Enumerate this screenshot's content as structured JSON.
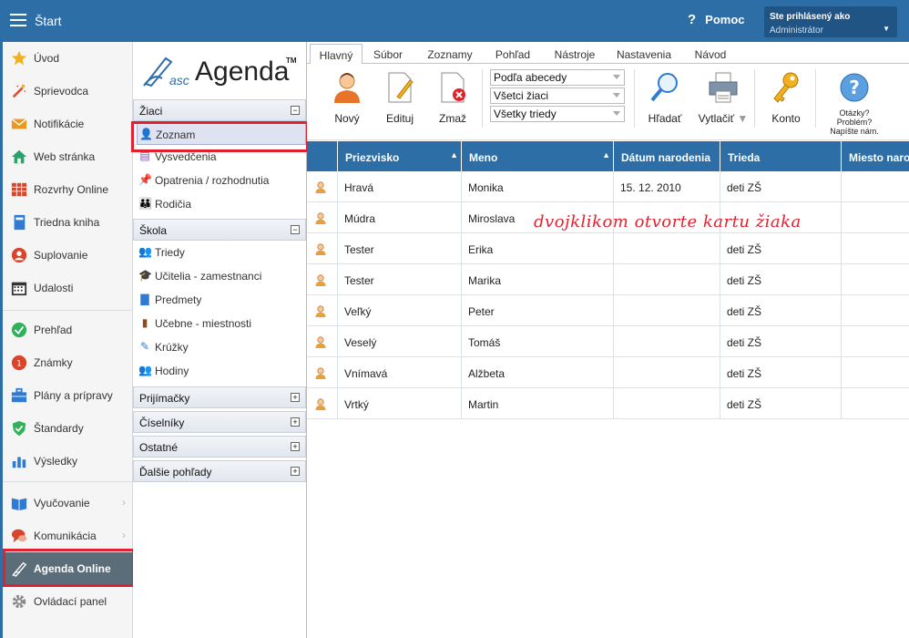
{
  "topbar": {
    "title": "Štart",
    "help": "Pomoc",
    "user_line1": "Ste prihlásený ako",
    "user_line2": "Administrátor"
  },
  "sidebar": {
    "items": [
      {
        "label": "Úvod",
        "icon": "star-icon",
        "color": "#f2b01e"
      },
      {
        "label": "Sprievodca",
        "icon": "magic-wand-icon",
        "color": "#e05030"
      },
      {
        "label": "Notifikácie",
        "icon": "envelope-icon",
        "color": "#e89a20"
      },
      {
        "label": "Web stránka",
        "icon": "home-icon",
        "color": "#2aa36a"
      },
      {
        "label": "Rozvrhy Online",
        "icon": "timetable-icon",
        "color": "#d9452b"
      },
      {
        "label": "Triedna kniha",
        "icon": "book-icon",
        "color": "#2e7bd1"
      },
      {
        "label": "Suplovanie",
        "icon": "person-icon",
        "color": "#d9452b"
      },
      {
        "label": "Udalosti",
        "icon": "calendar-icon",
        "color": "#333333"
      },
      {
        "label": "Prehľad",
        "icon": "check-circle-icon",
        "color": "#33b05a"
      },
      {
        "label": "Známky",
        "icon": "grade-icon",
        "color": "#d9452b"
      },
      {
        "label": "Plány a prípravy",
        "icon": "briefcase-icon",
        "color": "#2e7bd1"
      },
      {
        "label": "Štandardy",
        "icon": "shield-check-icon",
        "color": "#33b05a"
      },
      {
        "label": "Výsledky",
        "icon": "bar-chart-icon",
        "color": "#2e7bd1"
      },
      {
        "label": "Vyučovanie",
        "icon": "open-book-icon",
        "color": "#2e7bd1"
      },
      {
        "label": "Komunikácia",
        "icon": "chat-icon",
        "color": "#d9452b"
      },
      {
        "label": "Agenda Online",
        "icon": "pen-icon",
        "color": "#ffffff"
      },
      {
        "label": "Ovládací panel",
        "icon": "gear-icon",
        "color": "#888888"
      }
    ]
  },
  "nav": {
    "logo_asc": "asc",
    "logo_agenda": "Agenda",
    "logo_tm": "TM",
    "groups": {
      "ziaci": "Žiaci",
      "skola": "Škola",
      "prijimacky": "Prijímačky",
      "ciselniky": "Číselníky",
      "ostatne": "Ostatné",
      "dalsie": "Ďalšie pohľady"
    },
    "ziaci_items": [
      "Zoznam",
      "Vysvedčenia",
      "Opatrenia / rozhodnutia",
      "Rodičia"
    ],
    "skola_items": [
      "Triedy",
      "Učitelia - zamestnanci",
      "Predmety",
      "Učebne - miestnosti",
      "Krúžky",
      "Hodiny"
    ],
    "minus": "−",
    "plus": "+"
  },
  "tabs": [
    "Hlavný",
    "Súbor",
    "Zoznamy",
    "Pohľad",
    "Nástroje",
    "Nastavenia",
    "Návod"
  ],
  "ribbon": {
    "novy": "Nový",
    "edituj": "Edituj",
    "zmaz": "Zmaž",
    "sort_select": "Podľa abecedy",
    "students_select": "Všetci žiaci",
    "classes_select": "Všetky triedy",
    "hladat": "Hľadať",
    "vytlacit": "Vytlačiť",
    "konto": "Konto",
    "help_l1": "Otázky?",
    "help_l2": "Problém?",
    "help_l3": "Napíšte nám."
  },
  "table": {
    "headers": [
      "Priezvisko",
      "Meno",
      "Dátum narodenia",
      "Trieda",
      "Miesto naro"
    ],
    "rows": [
      [
        "Hravá",
        "Monika",
        "15. 12. 2010",
        "deti ZŠ"
      ],
      [
        "Múdra",
        "Miroslava",
        "",
        ""
      ],
      [
        "Tester",
        "Erika",
        "",
        "deti ZŠ"
      ],
      [
        "Tester",
        "Marika",
        "",
        "deti ZŠ"
      ],
      [
        "Veľký",
        "Peter",
        "",
        "deti ZŠ"
      ],
      [
        "Veselý",
        "Tomáš",
        "",
        "deti ZŠ"
      ],
      [
        "Vnímavá",
        "Alžbeta",
        "",
        "deti ZŠ"
      ],
      [
        "Vrtký",
        "Martin",
        "",
        "deti ZŠ"
      ]
    ]
  },
  "annotation": "dvojklikom otvorte kartu žiaka",
  "colors": {
    "header_blue": "#2e6ea6",
    "highlight_red": "#e3202e",
    "active_item": "#5c6d7a"
  }
}
